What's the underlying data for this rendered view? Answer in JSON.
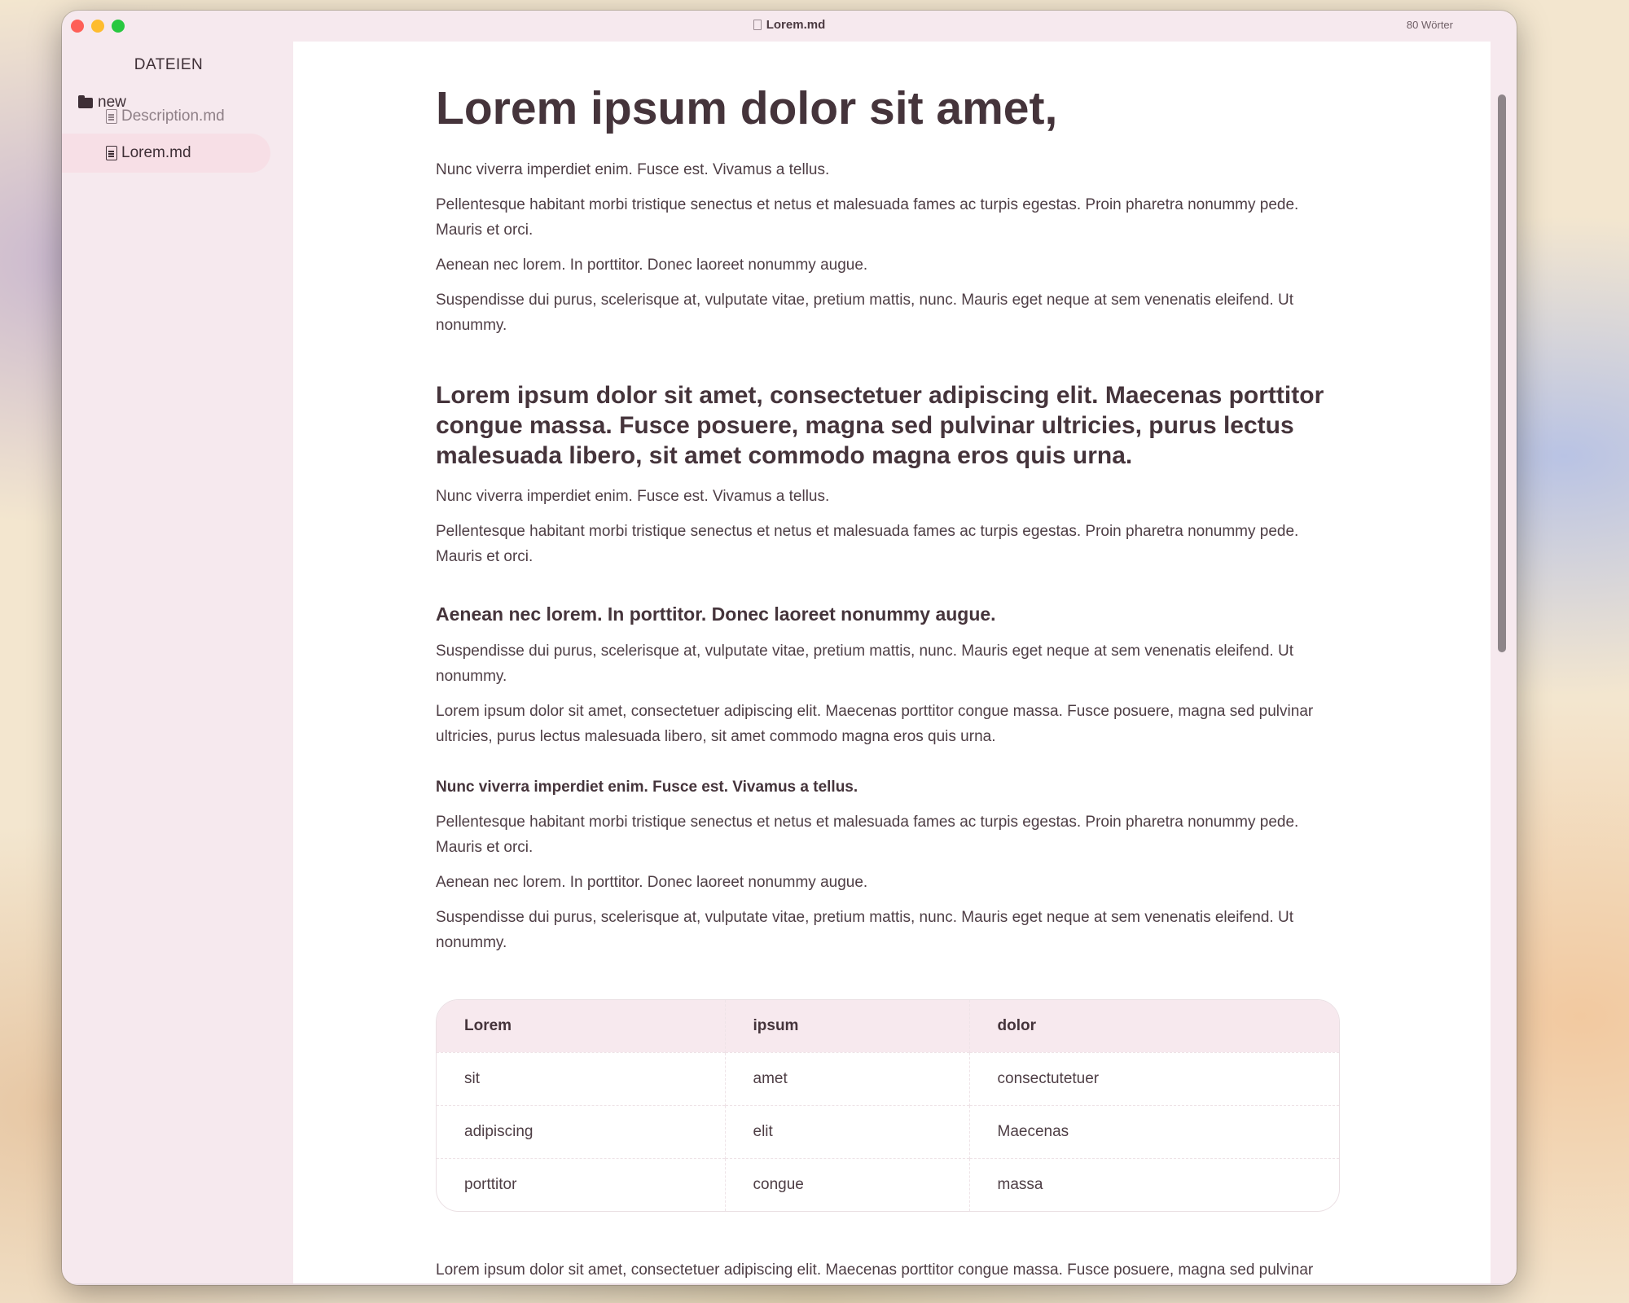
{
  "window": {
    "title": "Lorem.md",
    "word_count": "80 Wörter"
  },
  "sidebar": {
    "title": "DATEIEN",
    "folder": "new",
    "files": [
      {
        "label": "Description.md",
        "active": false
      },
      {
        "label": "Lorem.md",
        "active": true
      }
    ]
  },
  "document": {
    "h1": "Lorem ipsum dolor sit amet,",
    "p1": "Nunc viverra imperdiet enim. Fusce est. Vivamus a tellus.",
    "p2": "Pellentesque habitant morbi tristique senectus et netus et malesuada fames ac turpis egestas. Proin pharetra nonummy pede. Mauris et orci.",
    "p3": "Aenean nec lorem. In porttitor. Donec laoreet nonummy augue.",
    "p4": "Suspendisse dui purus, scelerisque at, vulputate vitae, pretium mattis, nunc. Mauris eget neque at sem venenatis eleifend. Ut nonummy.",
    "h2": "Lorem ipsum dolor sit amet, consectetuer adipiscing elit. Maecenas porttitor congue massa. Fusce posuere, magna sed pulvinar ultricies, purus lectus malesuada libero, sit amet commodo magna eros quis urna.",
    "p5": "Nunc viverra imperdiet enim. Fusce est. Vivamus a tellus.",
    "p6": "Pellentesque habitant morbi tristique senectus et netus et malesuada fames ac turpis egestas. Proin pharetra nonummy pede. Mauris et orci.",
    "h3": "Aenean nec lorem. In porttitor. Donec laoreet nonummy augue.",
    "p7": "Suspendisse dui purus, scelerisque at, vulputate vitae, pretium mattis, nunc. Mauris eget neque at sem venenatis eleifend. Ut nonummy.",
    "p8": " Lorem ipsum dolor sit amet, consectetuer adipiscing elit. Maecenas porttitor congue massa. Fusce posuere, magna sed pulvinar ultricies, purus lectus malesuada libero, sit amet commodo magna eros quis urna.",
    "h4": "Nunc viverra imperdiet enim. Fusce est. Vivamus a tellus.",
    "p9": "Pellentesque habitant morbi tristique senectus et netus et malesuada fames ac turpis egestas. Proin pharetra nonummy pede. Mauris et orci.",
    "p10": "Aenean nec lorem. In porttitor. Donec laoreet nonummy augue.",
    "p11": "Suspendisse dui purus, scelerisque at, vulputate vitae, pretium mattis, nunc. Mauris eget neque at sem venenatis eleifend. Ut nonummy.",
    "table": {
      "headers": [
        "Lorem",
        "ipsum",
        "dolor"
      ],
      "rows": [
        [
          "sit",
          "amet",
          "consectutetuer"
        ],
        [
          "adipiscing",
          "elit",
          "Maecenas"
        ],
        [
          "porttitor",
          "congue",
          "massa"
        ]
      ]
    },
    "p12": " Lorem ipsum dolor sit amet, consectetuer adipiscing elit. Maecenas porttitor congue massa. Fusce posuere, magna sed pulvinar ultricies, purus lectus malesuada libero, sit amet commodo magna eros quis urna."
  },
  "colors": {
    "accent": "#f7dfe6",
    "sidebar_bg": "#f6e9ee",
    "text": "#4e3e45"
  }
}
